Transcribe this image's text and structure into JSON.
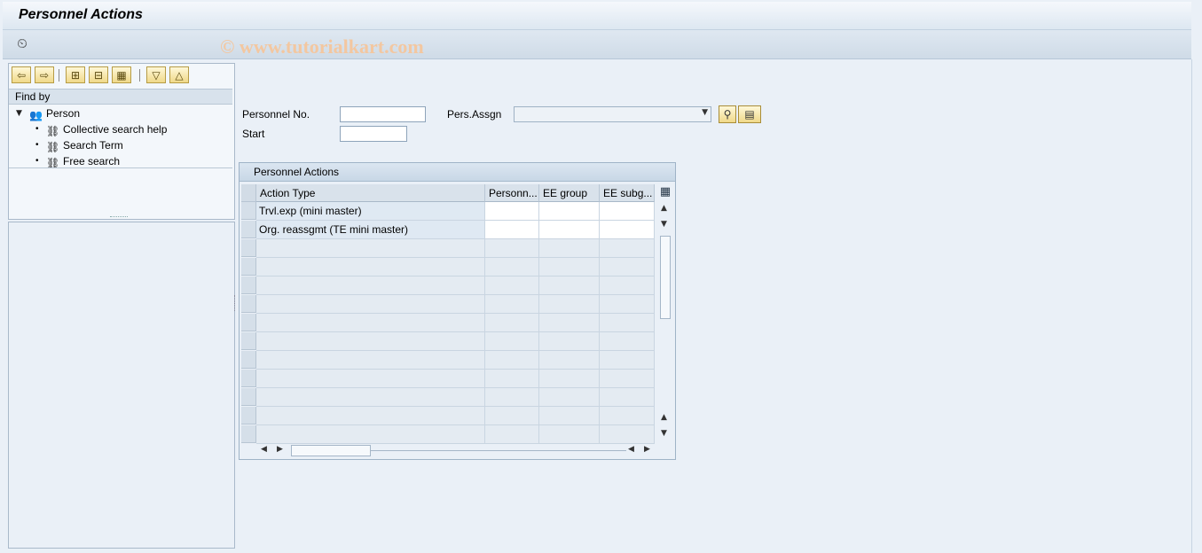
{
  "window": {
    "title": "Personnel Actions",
    "watermark": "© www.tutorialkart.com"
  },
  "toolbar": {
    "execute_icon": "execute-clock-icon"
  },
  "nav": {
    "buttons": [
      "arrow-left-icon",
      "arrow-right-icon",
      "expand-icon",
      "collapse-icon",
      "settings-icon",
      "scroll-down-icon",
      "scroll-up-icon"
    ],
    "find_by_label": "Find by",
    "root": {
      "label": "Person",
      "icon": "persons-icon"
    },
    "items": [
      {
        "label": "Collective search help",
        "icon": "binoculars-icon"
      },
      {
        "label": "Search Term",
        "icon": "binoculars-icon"
      },
      {
        "label": "Free search",
        "icon": "binoculars-icon"
      }
    ]
  },
  "form": {
    "personnel_no_label": "Personnel No.",
    "personnel_no_value": "",
    "start_label": "Start",
    "start_value": "",
    "pers_assgn_label": "Pers.Assgn",
    "pers_assgn_value": ""
  },
  "actions_table": {
    "title": "Personnel Actions",
    "columns": [
      "Action Type",
      "Personn...",
      "EE group",
      "EE subg..."
    ],
    "rows": [
      [
        "Trvl.exp (mini master)",
        "",
        "",
        ""
      ],
      [
        "Org. reassgmt (TE mini master)",
        "",
        "",
        ""
      ]
    ]
  },
  "colors": {
    "background": "#eaf0f7",
    "button_yellow": "#f0d98a",
    "header": "#d9e2eb"
  }
}
